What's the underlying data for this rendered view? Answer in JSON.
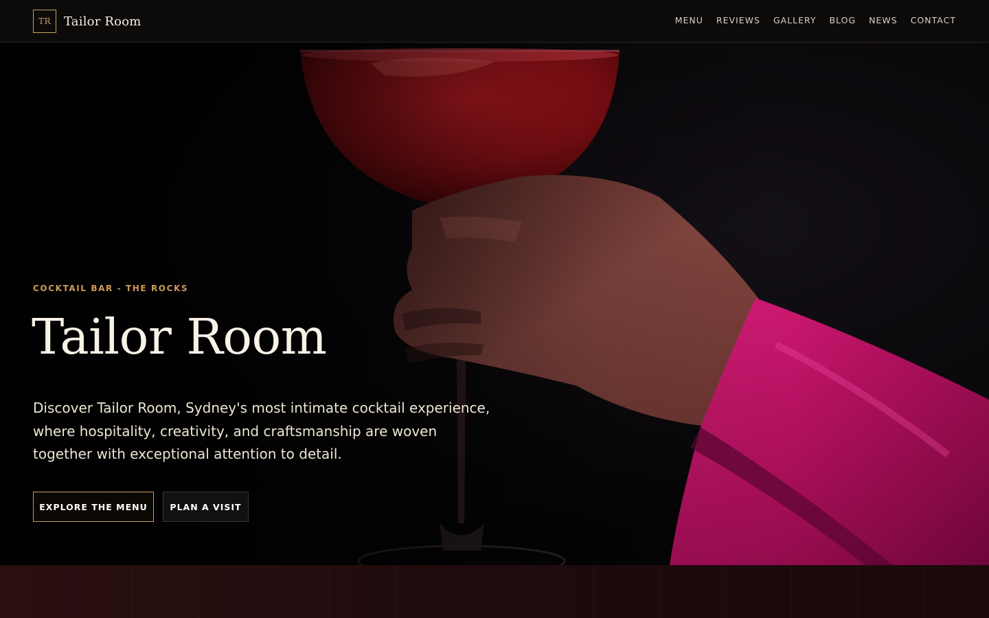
{
  "header": {
    "monogram": "TR",
    "brand": "Tailor Room",
    "nav": [
      "MENU",
      "REVIEWS",
      "GALLERY",
      "BLOG",
      "NEWS",
      "CONTACT"
    ]
  },
  "hero": {
    "eyebrow": "COCKTAIL BAR - THE ROCKS",
    "title": "Tailor Room",
    "description": "Discover Tailor Room, Sydney's most intimate cocktail experience, where hospitality, creativity, and craftsmanship are woven together with exceptional attention to detail.",
    "buttons": {
      "primary": "EXPLORE THE MENU",
      "secondary": "PLAN A VISIT"
    },
    "image": "hand holding red coupe cocktail, magenta satin sleeve"
  },
  "colors": {
    "accent": "#c9a063",
    "eyebrow": "#cf9a55",
    "background": "#0a0908",
    "band": "#2a0f10"
  }
}
